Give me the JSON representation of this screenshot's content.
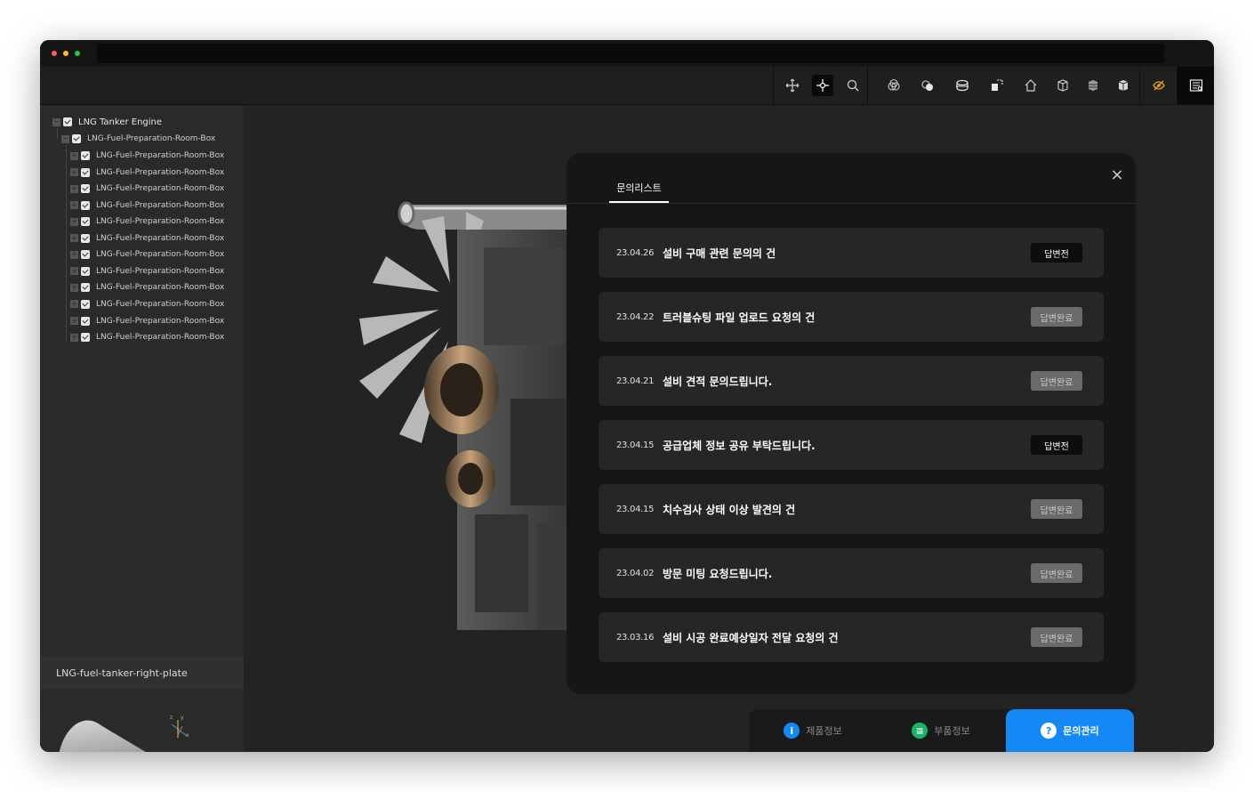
{
  "window": {
    "controls": [
      "close",
      "minimize",
      "maximize"
    ]
  },
  "toolbar": {
    "icons": [
      "move-icon",
      "pan-icon",
      "zoom-icon",
      "transparency-icon",
      "hide-icon",
      "section-icon",
      "explode-icon",
      "home-icon",
      "front-view-icon",
      "side-view-icon",
      "iso-view-icon",
      "visibility-toggle-icon",
      "list-panel-icon"
    ]
  },
  "tree": {
    "root": "LNG Tanker Engine",
    "child": "LNG-Fuel-Preparation-Room-Box",
    "items": [
      "LNG-Fuel-Preparation-Room-Box",
      "LNG-Fuel-Preparation-Room-Box",
      "LNG-Fuel-Preparation-Room-Box",
      "LNG-Fuel-Preparation-Room-Box",
      "LNG-Fuel-Preparation-Room-Box",
      "LNG-Fuel-Preparation-Room-Box",
      "LNG-Fuel-Preparation-Room-Box",
      "LNG-Fuel-Preparation-Room-Box",
      "LNG-Fuel-Preparation-Room-Box",
      "LNG-Fuel-Preparation-Room-Box",
      "LNG-Fuel-Preparation-Room-Box",
      "LNG-Fuel-Preparation-Room-Box"
    ]
  },
  "part": {
    "title": "LNG-fuel-tanker-right-plate",
    "axis_x": "x",
    "axis_y": "y",
    "axis_z": "z"
  },
  "modal": {
    "tab": "문의리스트",
    "close": "×",
    "inquiries": [
      {
        "date": "23.04.26",
        "title": "설비 구매 관련 문의의 건",
        "status": "답변전",
        "state": "pending"
      },
      {
        "date": "23.04.22",
        "title": "트러블슈팅 파일 업로드 요청의 건",
        "status": "답변완료",
        "state": "done"
      },
      {
        "date": "23.04.21",
        "title": "설비 견적 문의드립니다.",
        "status": "답변완료",
        "state": "done"
      },
      {
        "date": "23.04.15",
        "title": "공급업체 정보 공유 부탁드립니다.",
        "status": "답변전",
        "state": "pending"
      },
      {
        "date": "23.04.15",
        "title": "치수검사 상태 이상 발견의 건",
        "status": "답변완료",
        "state": "done"
      },
      {
        "date": "23.04.02",
        "title": "방문 미팅 요청드립니다.",
        "status": "답변완료",
        "state": "done"
      },
      {
        "date": "23.03.16",
        "title": "설비 시공 완료예상일자 전달 요청의 건",
        "status": "답변완료",
        "state": "done"
      }
    ]
  },
  "bottom_tabs": [
    {
      "label": "제품정보",
      "icon": "info-icon",
      "glyph": "i",
      "color": "#1488f5",
      "text_color": "#8a8a8a"
    },
    {
      "label": "부품정보",
      "icon": "parts-list-icon",
      "glyph": "≡",
      "color": "#19b46a",
      "text_color": "#8a8a8a"
    },
    {
      "label": "문의관리",
      "icon": "question-icon",
      "glyph": "?",
      "color": "#ffffff",
      "text_color": "#ffffff"
    }
  ],
  "colors": {
    "accent": "#1488f5",
    "pending_badge": "#0d0d0d",
    "done_badge": "#6a6a6a"
  }
}
